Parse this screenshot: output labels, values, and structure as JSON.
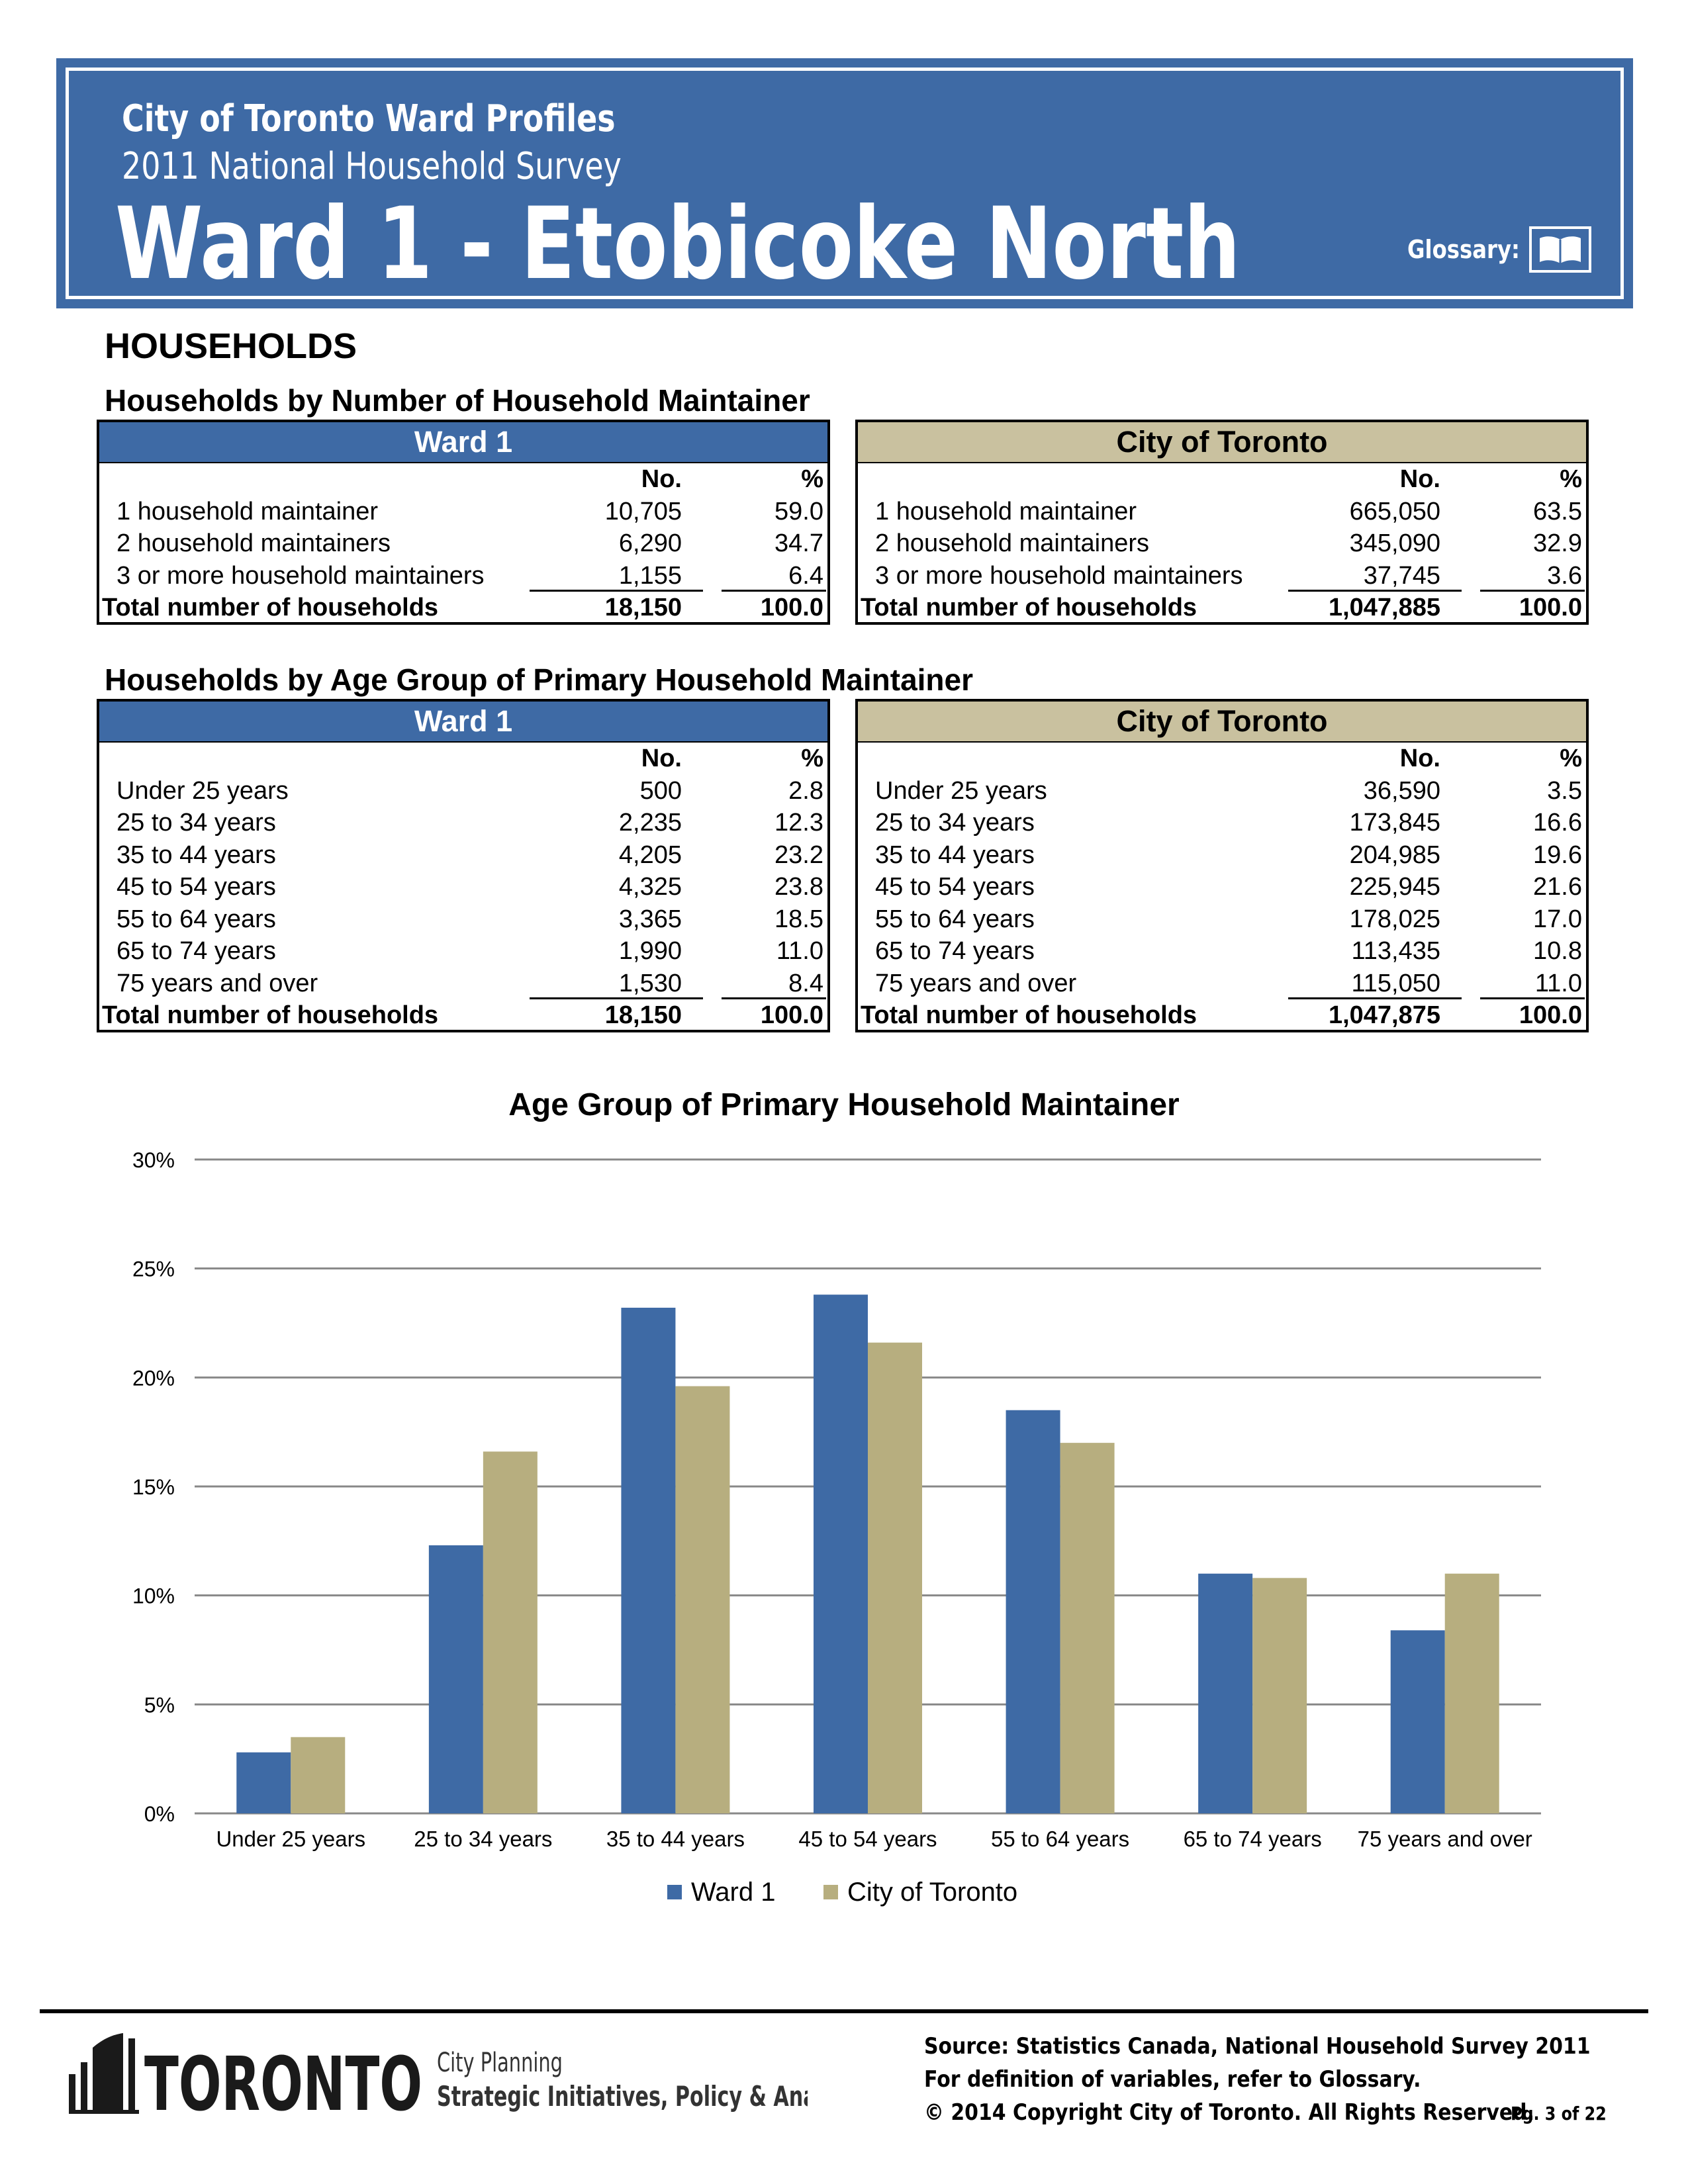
{
  "header": {
    "line1": "City of Toronto Ward Profiles",
    "line2": "2011 National Household Survey",
    "title": "Ward 1 - Etobicoke North",
    "glossary_label": "Glossary:",
    "glossary_icon": "open-book-icon"
  },
  "section_title": "HOUSEHOLDS",
  "table1": {
    "title": "Households by Number of Household Maintainer",
    "col_no": "No.",
    "col_pct": "%",
    "ward": {
      "header": "Ward 1",
      "rows": [
        {
          "label": "1 household maintainer",
          "no": "10,705",
          "pct": "59.0"
        },
        {
          "label": "2 household maintainers",
          "no": "6,290",
          "pct": "34.7"
        },
        {
          "label": "3 or more household maintainers",
          "no": "1,155",
          "pct": "6.4"
        }
      ],
      "total": {
        "label": "Total number of households",
        "no": "18,150",
        "pct": "100.0"
      }
    },
    "city": {
      "header": "City of Toronto",
      "rows": [
        {
          "label": "1 household maintainer",
          "no": "665,050",
          "pct": "63.5"
        },
        {
          "label": "2 household maintainers",
          "no": "345,090",
          "pct": "32.9"
        },
        {
          "label": "3 or more household maintainers",
          "no": "37,745",
          "pct": "3.6"
        }
      ],
      "total": {
        "label": "Total number of households",
        "no": "1,047,885",
        "pct": "100.0"
      }
    }
  },
  "table2": {
    "title": "Households by Age Group of Primary Household Maintainer",
    "col_no": "No.",
    "col_pct": "%",
    "ward": {
      "header": "Ward 1",
      "rows": [
        {
          "label": "Under 25 years",
          "no": "500",
          "pct": "2.8"
        },
        {
          "label": "25 to 34 years",
          "no": "2,235",
          "pct": "12.3"
        },
        {
          "label": "35 to 44 years",
          "no": "4,205",
          "pct": "23.2"
        },
        {
          "label": "45 to 54 years",
          "no": "4,325",
          "pct": "23.8"
        },
        {
          "label": "55 to 64 years",
          "no": "3,365",
          "pct": "18.5"
        },
        {
          "label": "65 to 74 years",
          "no": "1,990",
          "pct": "11.0"
        },
        {
          "label": "75 years and over",
          "no": "1,530",
          "pct": "8.4"
        }
      ],
      "total": {
        "label": "Total number of households",
        "no": "18,150",
        "pct": "100.0"
      }
    },
    "city": {
      "header": "City of Toronto",
      "rows": [
        {
          "label": "Under 25 years",
          "no": "36,590",
          "pct": "3.5"
        },
        {
          "label": "25 to 34 years",
          "no": "173,845",
          "pct": "16.6"
        },
        {
          "label": "35 to 44 years",
          "no": "204,985",
          "pct": "19.6"
        },
        {
          "label": "45 to 54 years",
          "no": "225,945",
          "pct": "21.6"
        },
        {
          "label": "55 to 64 years",
          "no": "178,025",
          "pct": "17.0"
        },
        {
          "label": "65 to 74 years",
          "no": "113,435",
          "pct": "10.8"
        },
        {
          "label": "75 years and over",
          "no": "115,050",
          "pct": "11.0"
        }
      ],
      "total": {
        "label": "Total number of households",
        "no": "1,047,875",
        "pct": "100.0"
      }
    }
  },
  "chart_data": {
    "type": "bar",
    "title": "Age Group of Primary Household Maintainer",
    "categories": [
      "Under 25 years",
      "25 to 34 years",
      "35 to 44 years",
      "45 to 54 years",
      "55 to 64 years",
      "65 to 74 years",
      "75 years and over"
    ],
    "series": [
      {
        "name": "Ward 1",
        "color": "#3e6aa5",
        "values": [
          2.8,
          12.3,
          23.2,
          23.8,
          18.5,
          11.0,
          8.4
        ]
      },
      {
        "name": "City of Toronto",
        "color": "#b7ae7f",
        "values": [
          3.5,
          16.6,
          19.6,
          21.6,
          17.0,
          10.8,
          11.0
        ]
      }
    ],
    "ylim": [
      0,
      30
    ],
    "yticks": [
      "0%",
      "5%",
      "10%",
      "15%",
      "20%",
      "25%",
      "30%"
    ],
    "grid": true,
    "legend": "bottom"
  },
  "footer": {
    "logo_text": "TORONTO",
    "dept_line1": "City Planning",
    "dept_line2": "Strategic Initiatives, Policy & Analysis",
    "source1": "Source: Statistics Canada, National Household Survey 2011",
    "source2": "For definition of variables, refer to Glossary.",
    "copyright": "© 2014 Copyright City of Toronto.  All Rights Reserved.",
    "page": "Pg. 3 of 22"
  }
}
